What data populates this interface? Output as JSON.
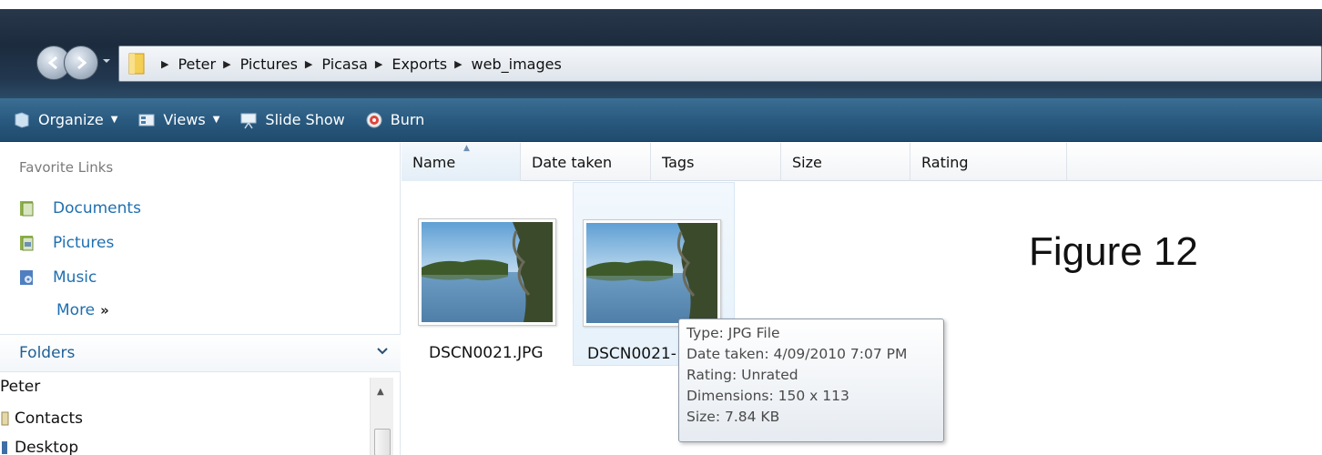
{
  "address_bar": {
    "breadcrumbs": [
      "Peter",
      "Pictures",
      "Picasa",
      "Exports",
      "web_images"
    ]
  },
  "toolbar": {
    "organize": "Organize",
    "views": "Views",
    "slideshow": "Slide Show",
    "burn": "Burn"
  },
  "navpane": {
    "favorite_links_title": "Favorite Links",
    "favorites": [
      {
        "label": "Documents",
        "icon": "documents-icon"
      },
      {
        "label": "Pictures",
        "icon": "pictures-icon"
      },
      {
        "label": "Music",
        "icon": "music-icon"
      }
    ],
    "more_label": "More",
    "more_glyph": "»",
    "folders_label": "Folders",
    "tree": [
      "Peter",
      "Contacts",
      "Desktop"
    ]
  },
  "columns": {
    "name": "Name",
    "date_taken": "Date taken",
    "tags": "Tags",
    "size": "Size",
    "rating": "Rating"
  },
  "files": [
    {
      "name": "DSCN0021.JPG"
    },
    {
      "name": "DSCN0021-"
    }
  ],
  "tooltip": {
    "type": "Type: JPG File",
    "date_taken": "Date taken: 4/09/2010 7:07 PM",
    "rating": "Rating: Unrated",
    "dimensions": "Dimensions: 150 x 113",
    "size": "Size: 7.84 KB"
  },
  "figure_label": "Figure 12",
  "colors": {
    "toolbar": "#2a5a80",
    "link": "#1f6fb0",
    "titlebar": "#1c2b3d"
  }
}
